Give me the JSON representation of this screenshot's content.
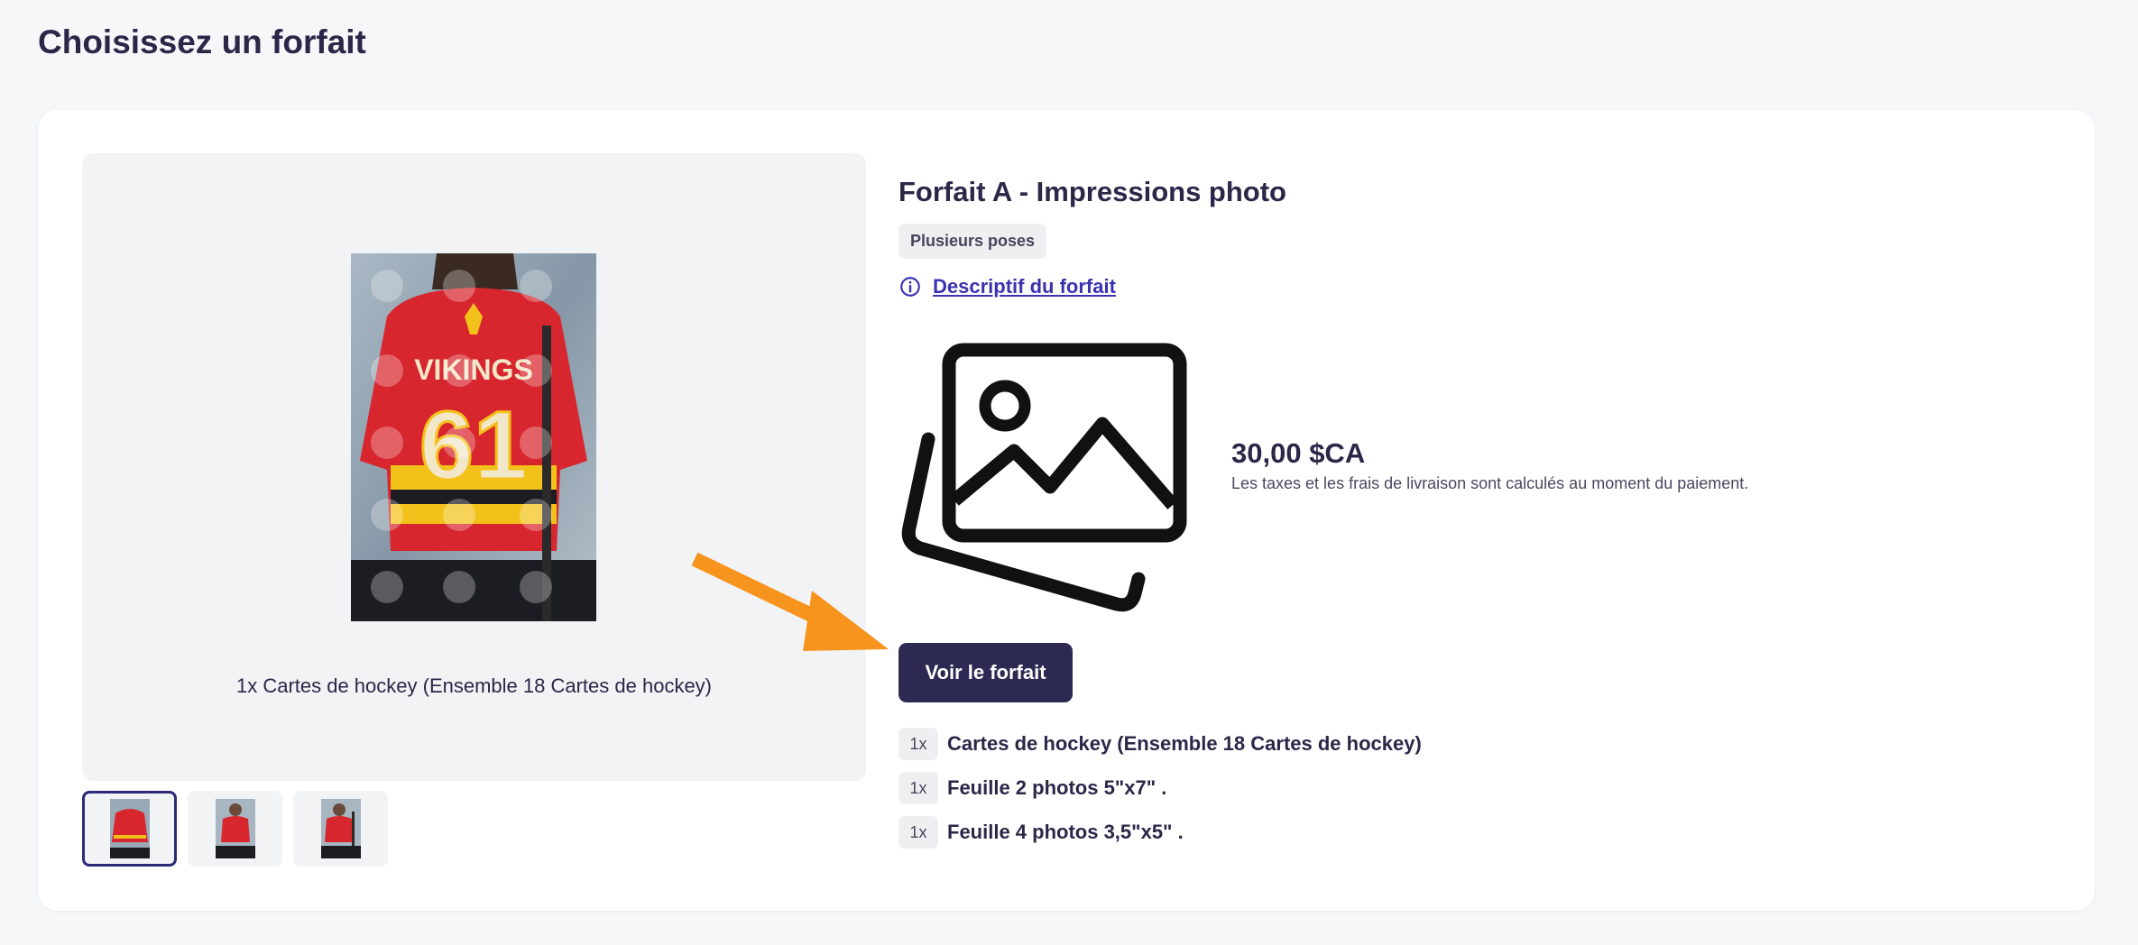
{
  "page": {
    "title": "Choisissez un forfait"
  },
  "gallery": {
    "caption": "1x Cartes de hockey (Ensemble 18 Cartes de hockey)",
    "jersey_team_text": "VIKINGS",
    "jersey_number": "61",
    "thumbnails": [
      {
        "name": "thumbnail-1",
        "active": true
      },
      {
        "name": "thumbnail-2",
        "active": false
      },
      {
        "name": "thumbnail-3",
        "active": false
      }
    ]
  },
  "product": {
    "title": "Forfait A - Impressions photo",
    "badge": "Plusieurs poses",
    "description_link": "Descriptif du forfait",
    "image_icon": "image-icon",
    "price": "30,00 $CA",
    "price_note": "Les taxes et les frais de livraison sont calculés au moment du paiement.",
    "cta_label": "Voir le forfait",
    "items": [
      {
        "qty": "1x",
        "label": "Cartes de hockey (Ensemble 18 Cartes de hockey)"
      },
      {
        "qty": "1x",
        "label": "Feuille 2 photos 5\"x7\" ."
      },
      {
        "qty": "1x",
        "label": "Feuille 4 photos 3,5\"x5\" ."
      }
    ]
  },
  "colors": {
    "accent": "#2c2a52",
    "link": "#3b32b0",
    "annotation_arrow": "#f7941d",
    "jersey_red": "#d8262f"
  }
}
